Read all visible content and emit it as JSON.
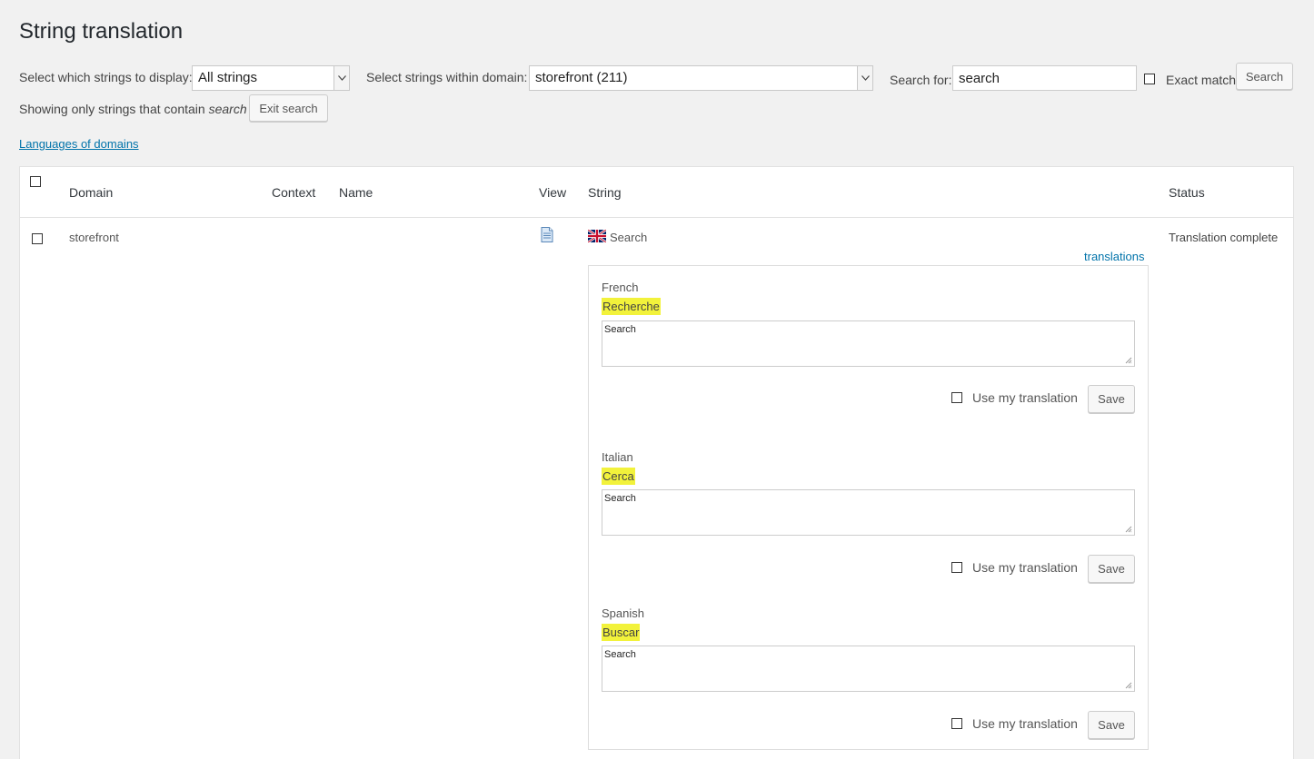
{
  "page_title": "String translation",
  "filters": {
    "display_label": "Select which strings to display:",
    "display_value": "All strings",
    "domain_label": "Select strings within domain:",
    "domain_value": "storefront (211)",
    "search_label": "Search for:",
    "search_value": "search",
    "exact_match_label": "Exact match",
    "search_button": "Search",
    "showing_prefix": "Showing only strings that contain",
    "showing_term": "search",
    "exit_search_button": "Exit search"
  },
  "languages_link": "Languages of domains",
  "table": {
    "headers": {
      "domain": "Domain",
      "context": "Context",
      "name": "Name",
      "view": "View",
      "string": "String",
      "status": "Status"
    },
    "row": {
      "domain": "storefront",
      "string": "Search",
      "status": "Translation complete",
      "translations_link": "translations",
      "translations": [
        {
          "language": "French",
          "translated": "Recherche",
          "textarea": "Search",
          "use_label": "Use my translation",
          "save": "Save"
        },
        {
          "language": "Italian",
          "translated": "Cerca",
          "textarea": "Search",
          "use_label": "Use my translation",
          "save": "Save"
        },
        {
          "language": "Spanish",
          "translated": "Buscar",
          "textarea": "Search",
          "use_label": "Use my translation",
          "save": "Save"
        }
      ]
    }
  },
  "colors": {
    "highlight": "#f2f23b",
    "link": "#0073aa"
  }
}
